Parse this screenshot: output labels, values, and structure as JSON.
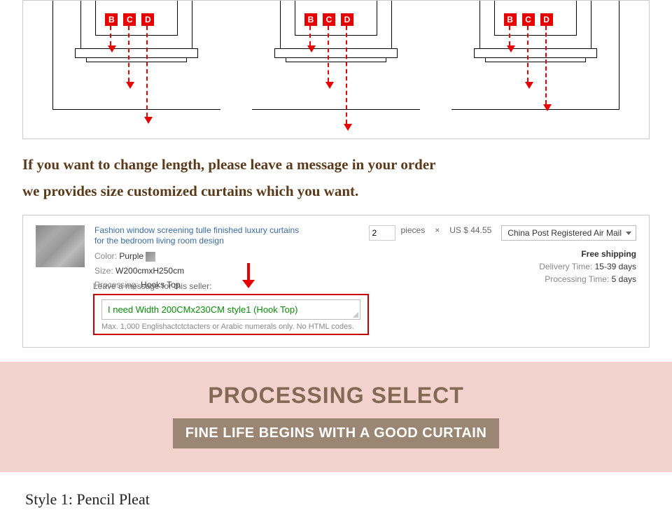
{
  "diagrams": {
    "labels": [
      "B",
      "C",
      "D"
    ]
  },
  "instruction": {
    "line1": "If you want to change length, please leave a message in your order",
    "line2": "we provides size customized curtains which you want."
  },
  "order": {
    "product_title": "Fashion window screening tulle finished luxury curtains for the bedroom living room design",
    "color_label": "Color:",
    "color_value": "Purple",
    "size_label": "Size:",
    "size_value": "W200cmxH250cm",
    "processing_label": "Processing:",
    "processing_value": "Hooks Top",
    "qty_value": "2",
    "qty_unit": "pieces",
    "times": "×",
    "price": "US $ 44.55",
    "ship_method": "China Post Registered Air Mail",
    "free_shipping": "Free shipping",
    "delivery_label": "Delivery Time:",
    "delivery_value": "15-39 days",
    "proc_time_label": "Processing Time:",
    "proc_time_value": "5 days",
    "msg_label": "Leave a message for this seller:",
    "msg_value": "I need Width 200CMx230CM style1 (Hook Top)",
    "msg_hint": "Max. 1,000 Englishactctctacters or Arabic numerals only. No HTML codes."
  },
  "banner": {
    "title": "PROCESSING SELECT",
    "subtitle": "FINE LIFE BEGINS WITH A GOOD CURTAIN"
  },
  "style_heading": "Style 1: Pencil Pleat"
}
